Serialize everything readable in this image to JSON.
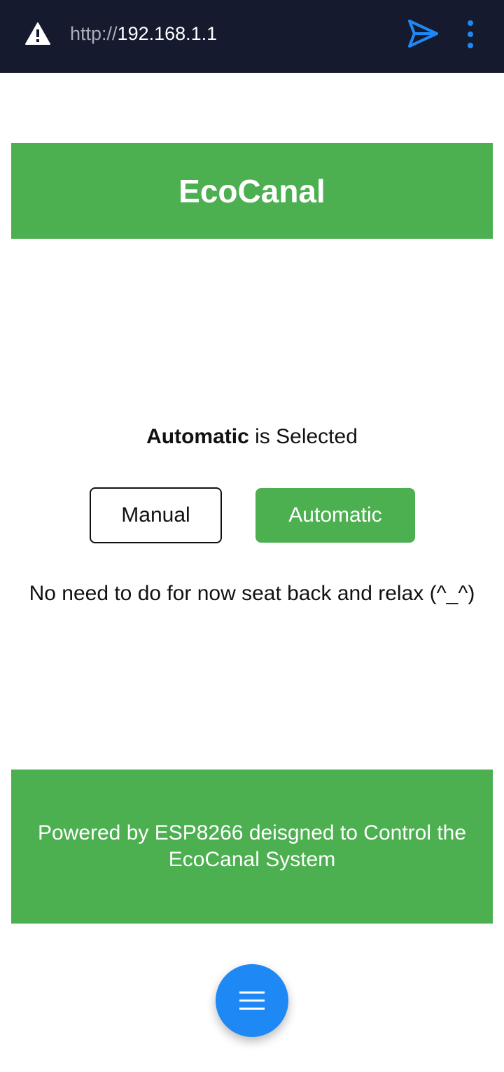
{
  "browser": {
    "url_scheme": "http://",
    "url_host": "192.168.1.1",
    "icons": [
      "warning-icon",
      "send-icon",
      "more-vert-icon"
    ],
    "background": "#161a2e",
    "accent": "#1e88f5"
  },
  "header": {
    "title": "EcoCanal"
  },
  "mode": {
    "selected": "Automatic",
    "suffix": " is Selected",
    "manual_label": "Manual",
    "automatic_label": "Automatic"
  },
  "message": "No need to do for now seat back and relax (^_^)",
  "footer": {
    "text": "Powered by ESP8266 deisgned to Control the EcoCanal System"
  },
  "fab": {
    "icon": "hamburger-menu-icon"
  },
  "colors": {
    "brand_green": "#4caf50",
    "fab_blue": "#1e88f5"
  }
}
